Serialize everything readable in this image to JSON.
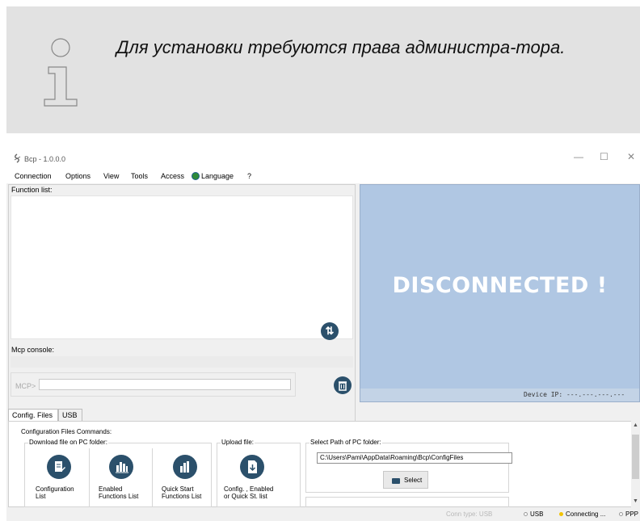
{
  "note": {
    "text": "Для установки требуются права администра-тора."
  },
  "window": {
    "title": "Bcp - 1.0.0.0",
    "minimize": "—",
    "maximize": "☐",
    "close": "✕"
  },
  "menu": {
    "items": [
      "Connection",
      "Options",
      "View",
      "Tools",
      "Access",
      "Language",
      "?"
    ]
  },
  "left": {
    "function_list_label": "Function list:",
    "console_label": "Mcp console:",
    "mcp_prompt": "MCP>",
    "mcp_input_value": ""
  },
  "display": {
    "status": "DISCONNECTED !",
    "device_ip": "Device IP: ---.---.---.---"
  },
  "tabs": {
    "config": "Config. Files",
    "usb": "USB"
  },
  "config": {
    "commands_title": "Configuration Files Commands:",
    "download_label": "Download file on PC folder:",
    "upload_label": "Upload file:",
    "path_label": "Select Path of PC folder:",
    "path_value": "C:\\Users\\Pami\\AppData\\Roaming\\Bcp\\ConfigFiles",
    "select_button": "Select",
    "tools": [
      {
        "label": "Configuration\nList",
        "icon": "document-edit-icon"
      },
      {
        "label": "Enabled\nFunctions List",
        "icon": "bar-grid-icon"
      },
      {
        "label": "Quick Start\nFunctions List",
        "icon": "bar-chart-icon"
      },
      {
        "label": "Config. , Enabled\nor Quick St. list",
        "icon": "file-upload-icon"
      }
    ]
  },
  "status": {
    "conn_type": "Conn type: USB",
    "usb": "USB",
    "connecting": "Connecting ...",
    "ppp": "PPP",
    "colors": {
      "usb_dot": "#ffffff",
      "connecting_dot": "#f2c300",
      "ppp_dot": "#ffffff"
    }
  }
}
